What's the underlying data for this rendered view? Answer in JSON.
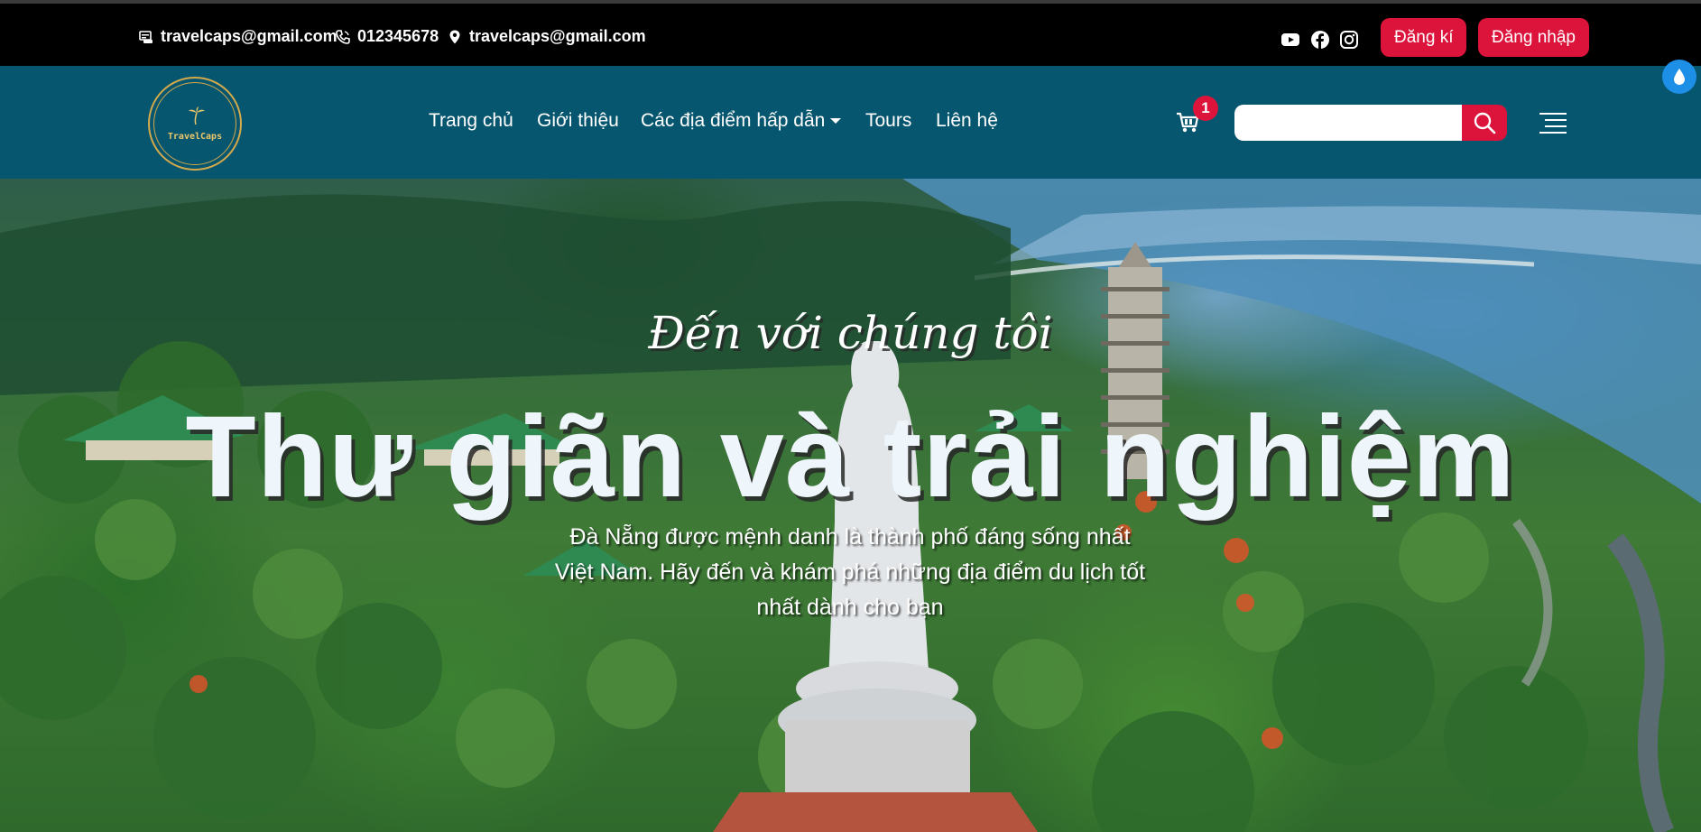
{
  "topbar": {
    "email_1": "travelcaps@gmail.com",
    "phone": "012345678",
    "email_2": "travelcaps@gmail.com",
    "email_1_icon": "address-card-icon",
    "phone_icon": "phone-icon",
    "email_2_icon": "map-marker-icon",
    "social": [
      "youtube-icon",
      "facebook-icon",
      "instagram-icon"
    ],
    "register_label": "Đăng kí",
    "login_label": "Đăng nhập"
  },
  "navbar": {
    "logo_text": "TravelCaps",
    "items": [
      {
        "label": "Trang chủ"
      },
      {
        "label": "Giới thiệu"
      },
      {
        "label": "Các địa điểm hấp dẫn"
      },
      {
        "label": "Tours"
      },
      {
        "label": "Liên hệ"
      }
    ],
    "cart_count": "1",
    "search_placeholder": ""
  },
  "hero": {
    "script_title": "Đến với chúng tôi",
    "title": "Thư giãn và trải nghiệm",
    "description": "Đà Nẵng được mệnh danh là thành phố đáng sống nhất Việt Nam. Hãy đến và khám phá những địa điểm du lịch tốt nhất dành cho bạn"
  },
  "colors": {
    "topbar_bg": "#000000",
    "navbar_bg": "#07566f",
    "accent_red": "#dc143c",
    "logo_gold": "#d4a94a",
    "floating_button": "#1e8fe6"
  }
}
